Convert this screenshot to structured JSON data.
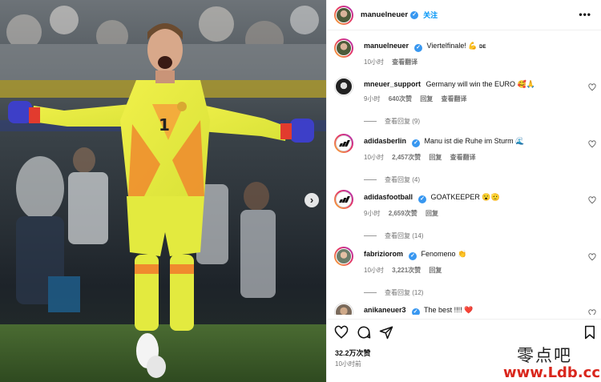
{
  "post": {
    "username": "manuelneuer",
    "follow_label": "关注",
    "more_label": "•••",
    "caption": "Viertelfinale! 💪",
    "caption_flag": "DE",
    "caption_time": "10小时",
    "caption_translate": "查看翻译",
    "likes": "32.2万次赞",
    "posted": "10小时前"
  },
  "comments": [
    {
      "user": "mneuer_support",
      "verified": false,
      "text": "Germany will win the EURO",
      "emoji": "🥰🙏",
      "time": "9小时",
      "likes": "640次赞",
      "reply": "回复",
      "translate": "查看翻译",
      "replies": "查看回复 (9)"
    },
    {
      "user": "adidasberlin",
      "verified": true,
      "text": "Manu ist die Ruhe im Sturm",
      "emoji": "🌊",
      "time": "10小时",
      "likes": "2,457次赞",
      "reply": "回复",
      "translate": "查看翻译",
      "replies": "查看回复 (4)"
    },
    {
      "user": "adidasfootball",
      "verified": true,
      "text": "GOATKEEPER",
      "emoji": "😮🫡",
      "time": "9小时",
      "likes": "2,659次赞",
      "reply": "回复",
      "translate": "",
      "replies": "查看回复 (14)"
    },
    {
      "user": "fabriziorom",
      "verified": true,
      "text": "Fenomeno",
      "emoji": "👏",
      "time": "10小时",
      "likes": "3,221次赞",
      "reply": "回复",
      "translate": "",
      "replies": "查看回复 (12)"
    },
    {
      "user": "anikaneuer3",
      "verified": true,
      "text": "The best !!!!",
      "emoji": "❤️",
      "time": "",
      "likes": "",
      "reply": "",
      "translate": "",
      "replies": ""
    }
  ],
  "icons": [
    "heart-icon",
    "comment-icon",
    "share-icon",
    "bookmark-icon",
    "next-arrow-icon",
    "verified-icon",
    "more-icon"
  ],
  "colors": {
    "accent": "#0095f6",
    "verified": "#3897f0",
    "jersey": "#e8ef3a",
    "watermark_red": "#d9261c"
  },
  "watermark": {
    "line1": "零点吧",
    "line2": "www.Ldb.cc"
  }
}
